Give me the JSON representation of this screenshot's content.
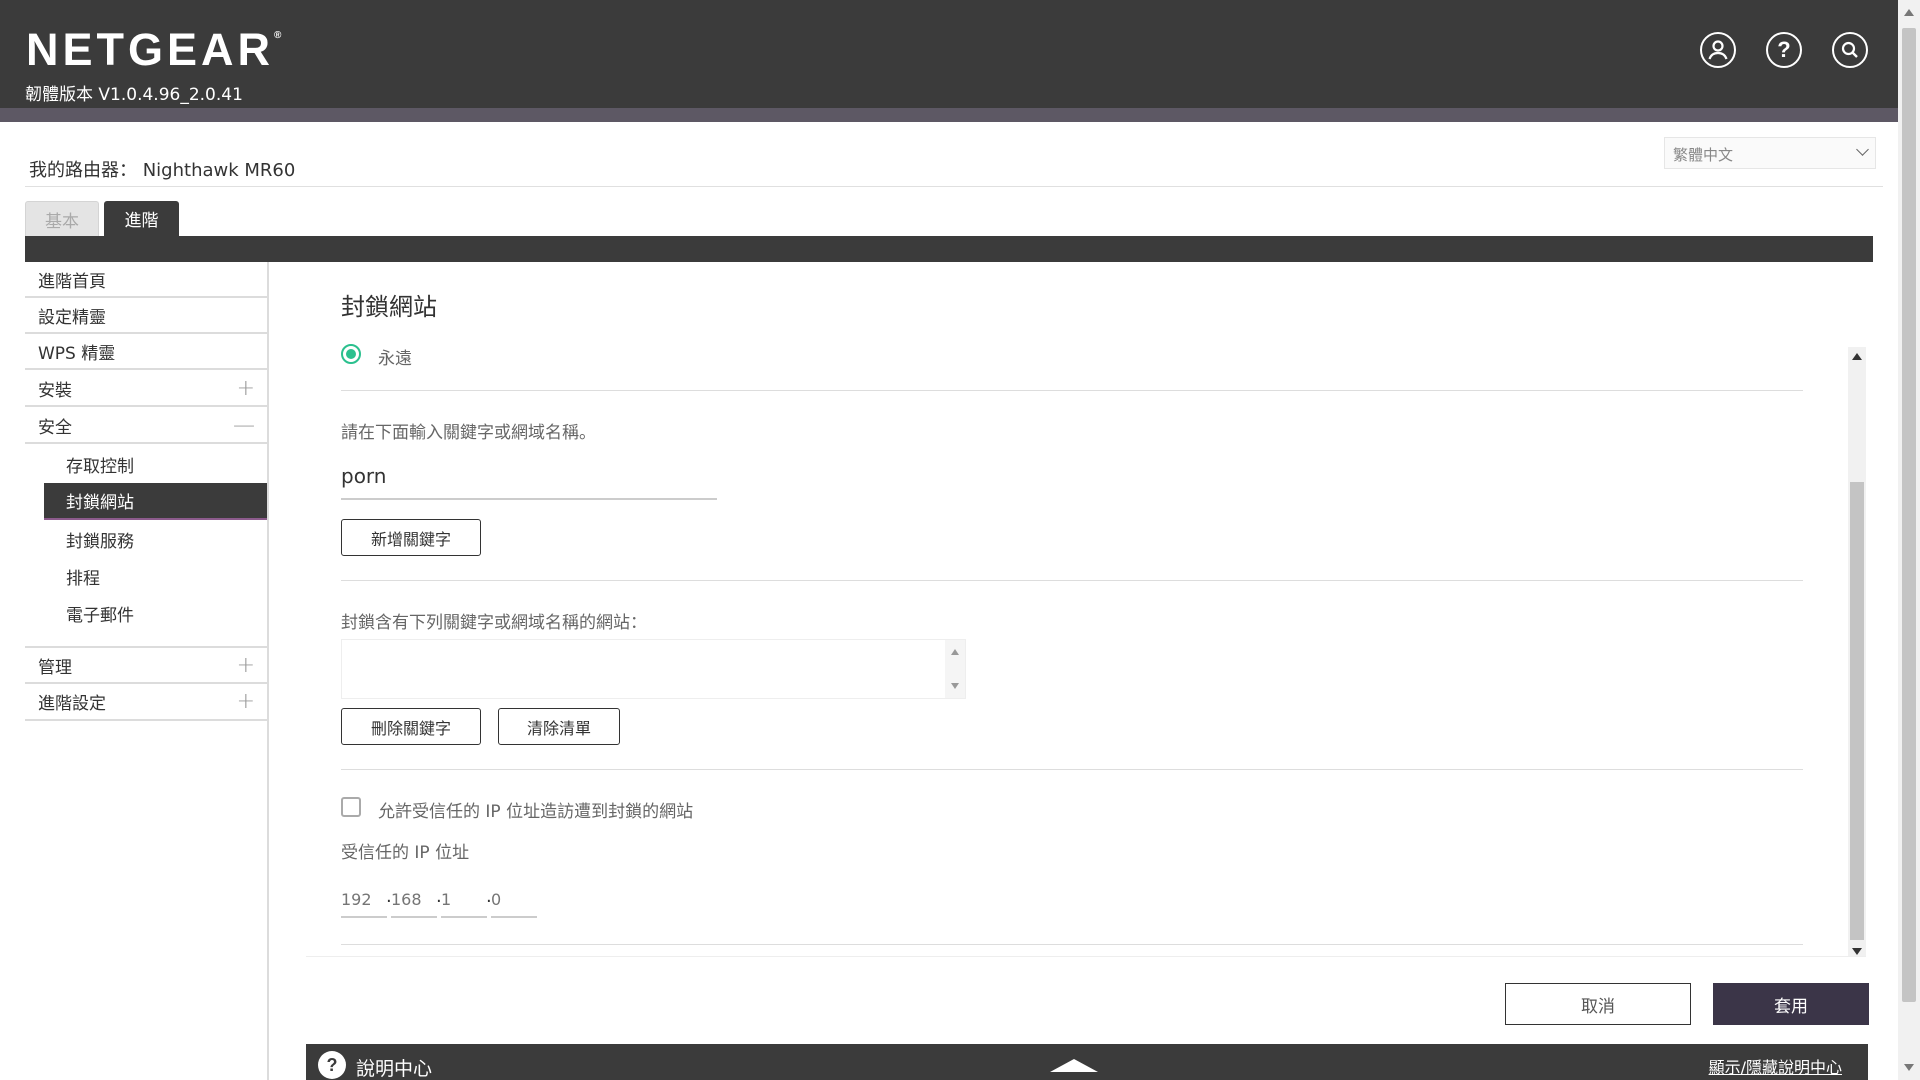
{
  "header": {
    "logo": "NETGEAR",
    "logo_mark": "®",
    "firmware": "韌體版本 V1.0.4.96_2.0.41",
    "icons": [
      "user-icon",
      "help-icon",
      "search-icon"
    ]
  },
  "router": {
    "label": "我的路由器： Nighthawk MR60"
  },
  "language": {
    "selected": "繁體中文"
  },
  "tabs": {
    "basic": "基本",
    "advanced": "進階"
  },
  "sidebar": {
    "items": [
      {
        "label": "進階首頁"
      },
      {
        "label": "設定精靈"
      },
      {
        "label": "WPS 精靈"
      },
      {
        "label": "安裝",
        "toggle": "+"
      },
      {
        "label": "安全",
        "toggle": "—"
      }
    ],
    "security_sub": [
      {
        "label": "存取控制"
      },
      {
        "label": "封鎖網站"
      },
      {
        "label": "封鎖服務"
      },
      {
        "label": "排程"
      },
      {
        "label": "電子郵件"
      }
    ],
    "items_bottom": [
      {
        "label": "管理",
        "toggle": "+"
      },
      {
        "label": "進階設定",
        "toggle": "+"
      }
    ]
  },
  "content": {
    "title": "封鎖網站",
    "radio_always": "永遠",
    "keyword_prompt": "請在下面輸入關鍵字或網域名稱。",
    "keyword_value": "porn",
    "add_keyword": "新增關鍵字",
    "block_list_label": "封鎖含有下列關鍵字或網域名稱的網站：",
    "delete_keyword": "刪除關鍵字",
    "clear_list": "清除清單",
    "allow_trusted": "允許受信任的 IP 位址造訪遭到封鎖的網站",
    "trusted_ip_label": "受信任的 IP 位址",
    "ip_placeholders": [
      "192",
      "168",
      "1",
      "0"
    ],
    "ip_separator": "."
  },
  "footer": {
    "cancel": "取消",
    "apply": "套用"
  },
  "helpbar": {
    "icon_text": "?",
    "title": "說明中心",
    "toggle": "顯示/隱藏說明中心"
  },
  "colors": {
    "header_bg": "#3b3b3b",
    "accent_green": "#2bc08e",
    "apply_bg": "#3b3548"
  }
}
